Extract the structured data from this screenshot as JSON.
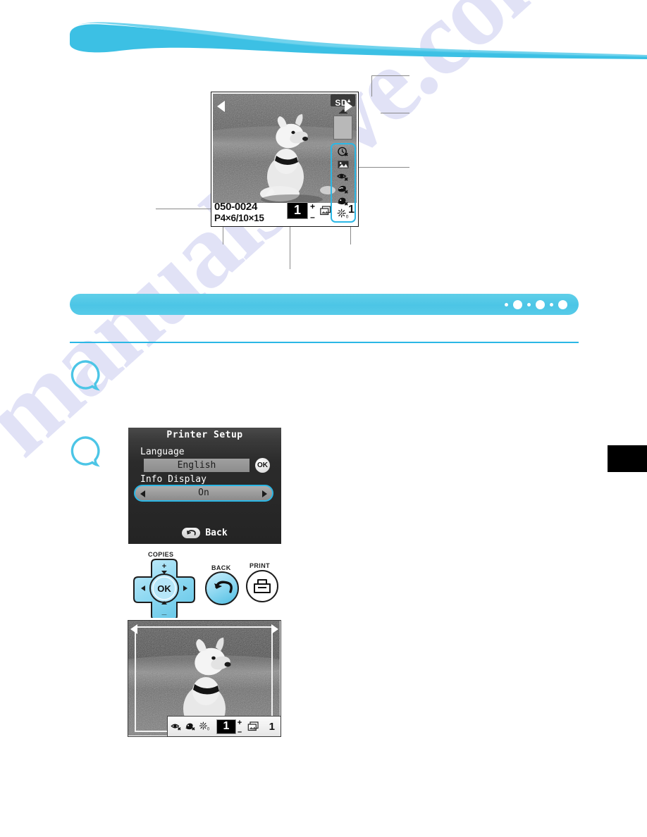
{
  "page": {
    "accent_color": "#2bb7e5",
    "bar_color": "#4cc5e6",
    "watermark": "manualshive.com"
  },
  "progress": {
    "dots": [
      "small",
      "large",
      "small",
      "large",
      "small",
      "large"
    ]
  },
  "steps": [
    {
      "marker": "step-bubble-1"
    },
    {
      "marker": "step-bubble-2"
    }
  ],
  "lcd_top": {
    "nav_left_icon": "triangle-left-icon",
    "nav_right_icon": "triangle-right-icon",
    "file_number": "050-0024",
    "paper_size": "P4×6/10×15",
    "copies": "1",
    "plus": "+",
    "minus": "–",
    "copies_stack_icon": "copies-stack-icon",
    "total_prints": "1",
    "card_badge": "SD",
    "card_badge_mark": "▴",
    "eject_icon": "eject-arrow-icon",
    "card_icon": "memory-card-icon",
    "settings_icons": [
      {
        "name": "date-off-icon",
        "label": "Date off"
      },
      {
        "name": "image-optimize-icon",
        "label": "Image optimize"
      },
      {
        "name": "red-eye-off-icon",
        "label": "Red-Eye Corr. off"
      },
      {
        "name": "skin-smooth-off-icon",
        "label": "Smooth Skin off"
      },
      {
        "name": "face-brighten-off-icon",
        "label": "Face Brightener off"
      },
      {
        "name": "brightness-icon",
        "label": "Brightness",
        "value": "0"
      }
    ]
  },
  "setup_dialog": {
    "title": "Printer Setup",
    "language_label": "Language",
    "language_value": "English",
    "ok_label": "OK",
    "info_display_label": "Info Display",
    "info_display_value": "On",
    "left_arrow_icon": "triangle-left-icon",
    "right_arrow_icon": "triangle-right-icon",
    "back_label": "Back",
    "back_icon": "back-arrow-icon"
  },
  "buttons": {
    "copies_label": "COPIES",
    "ok_label": "OK",
    "up_icon": "up-plus-icon",
    "down_icon": "down-minus-icon",
    "left_icon": "left-arrow-icon",
    "right_icon": "right-arrow-icon",
    "back_label": "BACK",
    "back_icon": "back-arrow-icon",
    "print_label": "PRINT",
    "print_icon": "printer-icon"
  },
  "lcd_bottom": {
    "nav_left_icon": "triangle-left-icon",
    "nav_right_icon": "triangle-right-icon",
    "trim_frame": "crop-guide-frame",
    "status_icons": [
      {
        "name": "red-eye-off-icon"
      },
      {
        "name": "face-brighten-off-icon"
      },
      {
        "name": "brightness-icon",
        "value": "0"
      }
    ],
    "copies": "1",
    "plus": "+",
    "minus": "–",
    "copies_stack_icon": "copies-stack-icon",
    "total_prints": "1"
  }
}
